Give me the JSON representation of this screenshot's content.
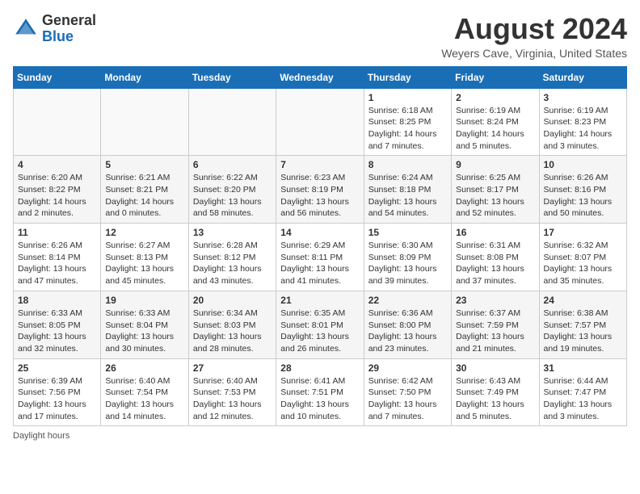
{
  "header": {
    "logo_general": "General",
    "logo_blue": "Blue",
    "month_year": "August 2024",
    "location": "Weyers Cave, Virginia, United States"
  },
  "calendar": {
    "days_of_week": [
      "Sunday",
      "Monday",
      "Tuesday",
      "Wednesday",
      "Thursday",
      "Friday",
      "Saturday"
    ],
    "weeks": [
      [
        {
          "day": "",
          "info": ""
        },
        {
          "day": "",
          "info": ""
        },
        {
          "day": "",
          "info": ""
        },
        {
          "day": "",
          "info": ""
        },
        {
          "day": "1",
          "info": "Sunrise: 6:18 AM\nSunset: 8:25 PM\nDaylight: 14 hours and 7 minutes."
        },
        {
          "day": "2",
          "info": "Sunrise: 6:19 AM\nSunset: 8:24 PM\nDaylight: 14 hours and 5 minutes."
        },
        {
          "day": "3",
          "info": "Sunrise: 6:19 AM\nSunset: 8:23 PM\nDaylight: 14 hours and 3 minutes."
        }
      ],
      [
        {
          "day": "4",
          "info": "Sunrise: 6:20 AM\nSunset: 8:22 PM\nDaylight: 14 hours and 2 minutes."
        },
        {
          "day": "5",
          "info": "Sunrise: 6:21 AM\nSunset: 8:21 PM\nDaylight: 14 hours and 0 minutes."
        },
        {
          "day": "6",
          "info": "Sunrise: 6:22 AM\nSunset: 8:20 PM\nDaylight: 13 hours and 58 minutes."
        },
        {
          "day": "7",
          "info": "Sunrise: 6:23 AM\nSunset: 8:19 PM\nDaylight: 13 hours and 56 minutes."
        },
        {
          "day": "8",
          "info": "Sunrise: 6:24 AM\nSunset: 8:18 PM\nDaylight: 13 hours and 54 minutes."
        },
        {
          "day": "9",
          "info": "Sunrise: 6:25 AM\nSunset: 8:17 PM\nDaylight: 13 hours and 52 minutes."
        },
        {
          "day": "10",
          "info": "Sunrise: 6:26 AM\nSunset: 8:16 PM\nDaylight: 13 hours and 50 minutes."
        }
      ],
      [
        {
          "day": "11",
          "info": "Sunrise: 6:26 AM\nSunset: 8:14 PM\nDaylight: 13 hours and 47 minutes."
        },
        {
          "day": "12",
          "info": "Sunrise: 6:27 AM\nSunset: 8:13 PM\nDaylight: 13 hours and 45 minutes."
        },
        {
          "day": "13",
          "info": "Sunrise: 6:28 AM\nSunset: 8:12 PM\nDaylight: 13 hours and 43 minutes."
        },
        {
          "day": "14",
          "info": "Sunrise: 6:29 AM\nSunset: 8:11 PM\nDaylight: 13 hours and 41 minutes."
        },
        {
          "day": "15",
          "info": "Sunrise: 6:30 AM\nSunset: 8:09 PM\nDaylight: 13 hours and 39 minutes."
        },
        {
          "day": "16",
          "info": "Sunrise: 6:31 AM\nSunset: 8:08 PM\nDaylight: 13 hours and 37 minutes."
        },
        {
          "day": "17",
          "info": "Sunrise: 6:32 AM\nSunset: 8:07 PM\nDaylight: 13 hours and 35 minutes."
        }
      ],
      [
        {
          "day": "18",
          "info": "Sunrise: 6:33 AM\nSunset: 8:05 PM\nDaylight: 13 hours and 32 minutes."
        },
        {
          "day": "19",
          "info": "Sunrise: 6:33 AM\nSunset: 8:04 PM\nDaylight: 13 hours and 30 minutes."
        },
        {
          "day": "20",
          "info": "Sunrise: 6:34 AM\nSunset: 8:03 PM\nDaylight: 13 hours and 28 minutes."
        },
        {
          "day": "21",
          "info": "Sunrise: 6:35 AM\nSunset: 8:01 PM\nDaylight: 13 hours and 26 minutes."
        },
        {
          "day": "22",
          "info": "Sunrise: 6:36 AM\nSunset: 8:00 PM\nDaylight: 13 hours and 23 minutes."
        },
        {
          "day": "23",
          "info": "Sunrise: 6:37 AM\nSunset: 7:59 PM\nDaylight: 13 hours and 21 minutes."
        },
        {
          "day": "24",
          "info": "Sunrise: 6:38 AM\nSunset: 7:57 PM\nDaylight: 13 hours and 19 minutes."
        }
      ],
      [
        {
          "day": "25",
          "info": "Sunrise: 6:39 AM\nSunset: 7:56 PM\nDaylight: 13 hours and 17 minutes."
        },
        {
          "day": "26",
          "info": "Sunrise: 6:40 AM\nSunset: 7:54 PM\nDaylight: 13 hours and 14 minutes."
        },
        {
          "day": "27",
          "info": "Sunrise: 6:40 AM\nSunset: 7:53 PM\nDaylight: 13 hours and 12 minutes."
        },
        {
          "day": "28",
          "info": "Sunrise: 6:41 AM\nSunset: 7:51 PM\nDaylight: 13 hours and 10 minutes."
        },
        {
          "day": "29",
          "info": "Sunrise: 6:42 AM\nSunset: 7:50 PM\nDaylight: 13 hours and 7 minutes."
        },
        {
          "day": "30",
          "info": "Sunrise: 6:43 AM\nSunset: 7:49 PM\nDaylight: 13 hours and 5 minutes."
        },
        {
          "day": "31",
          "info": "Sunrise: 6:44 AM\nSunset: 7:47 PM\nDaylight: 13 hours and 3 minutes."
        }
      ]
    ]
  },
  "footer": {
    "note": "Daylight hours"
  }
}
